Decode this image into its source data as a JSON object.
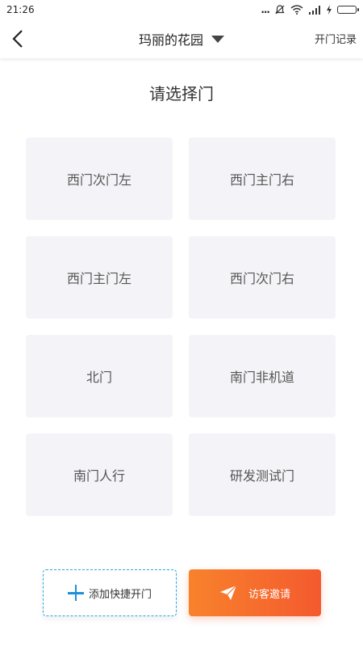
{
  "status_bar": {
    "time": "21:26",
    "dots": "...",
    "silent_icon": "bell-off-icon",
    "wifi_icon": "wifi-icon",
    "signal_icon": "signal-icon",
    "charging_icon": "lightning-icon",
    "battery_icon": "battery-icon"
  },
  "header": {
    "back_icon": "chevron-left-icon",
    "title": "玛丽的花园",
    "title_caret_icon": "caret-down-icon",
    "records_label": "开门记录"
  },
  "main": {
    "prompt": "请选择门",
    "doors": [
      {
        "label": "西门次门左"
      },
      {
        "label": "西门主门右"
      },
      {
        "label": "西门主门左"
      },
      {
        "label": "西门次门右"
      },
      {
        "label": "北门"
      },
      {
        "label": "南门非机道"
      },
      {
        "label": "南门人行"
      },
      {
        "label": "研发测试门"
      }
    ]
  },
  "actions": {
    "add_shortcut": {
      "label": "添加快捷开门",
      "icon": "plus-icon",
      "color": "#1e90d8"
    },
    "invite_visitor": {
      "label": "访客邀请",
      "icon": "paper-plane-icon",
      "color": "#f45a2e"
    }
  }
}
